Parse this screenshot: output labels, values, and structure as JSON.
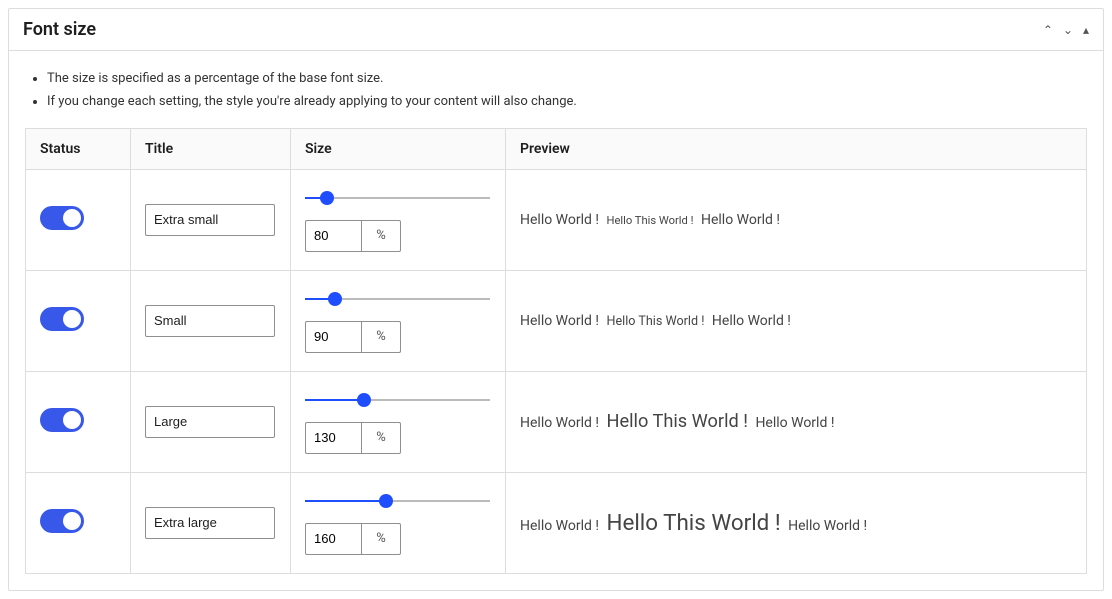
{
  "panel": {
    "title": "Font size",
    "notes": [
      "The size is specified as a percentage of the base font size.",
      "If you change each setting, the style you're already applying to your content will also change."
    ]
  },
  "headers": {
    "status": "Status",
    "title": "Title",
    "size": "Size",
    "preview": "Preview"
  },
  "unit_label": "%",
  "slider": {
    "min": 50,
    "max": 300
  },
  "preview_parts": {
    "a": "Hello World !",
    "b": "Hello This World !",
    "c": "Hello World !"
  },
  "rows": [
    {
      "enabled": true,
      "title": "Extra small",
      "size": 80
    },
    {
      "enabled": true,
      "title": "Small",
      "size": 90
    },
    {
      "enabled": true,
      "title": "Large",
      "size": 130
    },
    {
      "enabled": true,
      "title": "Extra large",
      "size": 160
    }
  ]
}
